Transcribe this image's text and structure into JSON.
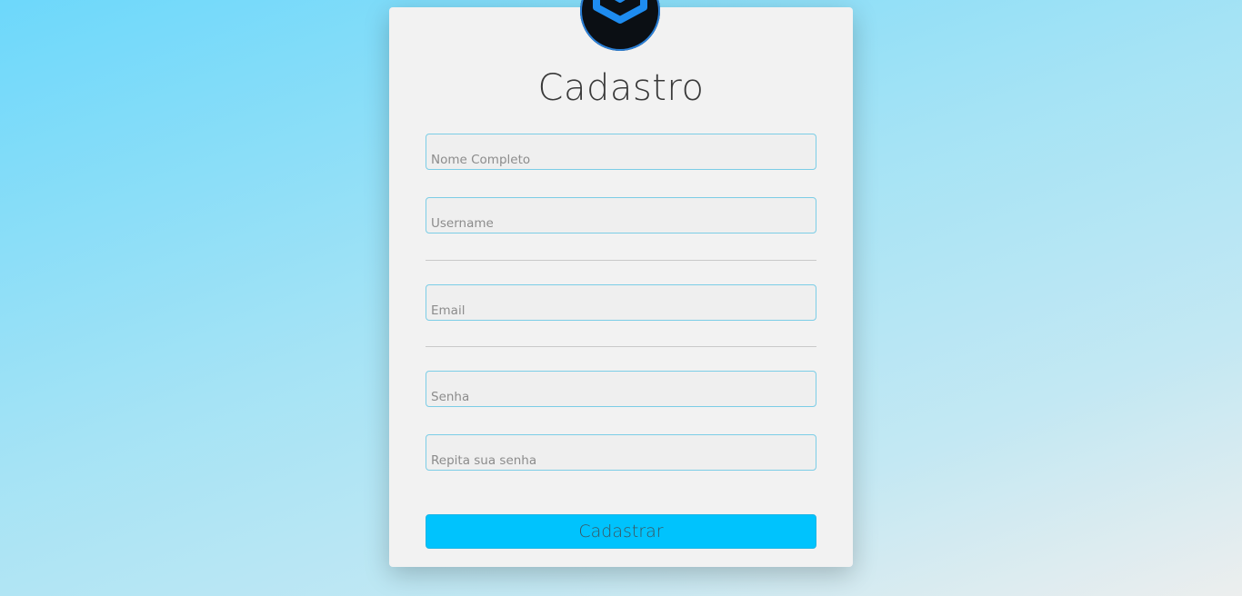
{
  "form": {
    "title": "Cadastro",
    "fields": {
      "full_name": {
        "placeholder": "Nome Completo",
        "value": ""
      },
      "username": {
        "placeholder": "Username",
        "value": ""
      },
      "email": {
        "placeholder": "Email",
        "value": ""
      },
      "password": {
        "placeholder": "Senha",
        "value": ""
      },
      "password_repeat": {
        "placeholder": "Repita sua senha",
        "value": ""
      }
    },
    "submit_label": "Cadastrar"
  },
  "logo": {
    "icon": "shield-box-logo-icon"
  },
  "colors": {
    "accent": "#00c3fd",
    "field_border": "#7ccde6",
    "card_bg": "#f2f2f2",
    "logo_blue": "#1e8cf0",
    "logo_bg": "#0b0f14"
  }
}
